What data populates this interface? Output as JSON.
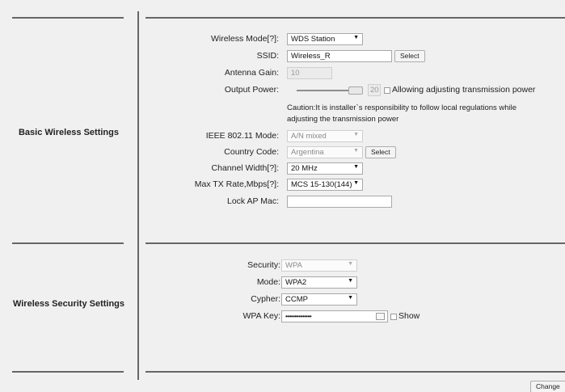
{
  "basic": {
    "title": "Basic Wireless Settings",
    "wireless_mode": {
      "label": "Wireless Mode[?]:",
      "value": "WDS Station"
    },
    "ssid": {
      "label": "SSID:",
      "value": "Wireless_R",
      "button": "Select"
    },
    "antenna_gain": {
      "label": "Antenna Gain:",
      "value": "10"
    },
    "output_power": {
      "label": "Output Power:",
      "value": "20",
      "checkbox_label": "Allowing adjusting transmission power"
    },
    "caution": "Caution:It is installer`s responsibility to follow local regulations while adjusting the transmission power",
    "ieee_mode": {
      "label": "IEEE 802.11 Mode:",
      "value": "A/N mixed"
    },
    "country": {
      "label": "Country Code:",
      "value": "Argentina",
      "button": "Select"
    },
    "channel_width": {
      "label": "Channel Width[?]:",
      "value": "20 MHz"
    },
    "max_tx": {
      "label": "Max TX Rate,Mbps[?]:",
      "value": "MCS 15-130(144)"
    },
    "lock_ap": {
      "label": "Lock AP Mac:",
      "value": ""
    }
  },
  "security": {
    "title": "Wireless Security Settings",
    "security": {
      "label": "Security:",
      "value": "WPA"
    },
    "mode": {
      "label": "Mode:",
      "value": "WPA2"
    },
    "cypher": {
      "label": "Cypher:",
      "value": "CCMP"
    },
    "wpa_key": {
      "label": "WPA Key:",
      "value": "••••••••••••••",
      "show_label": "Show"
    }
  },
  "change_button": "Change"
}
